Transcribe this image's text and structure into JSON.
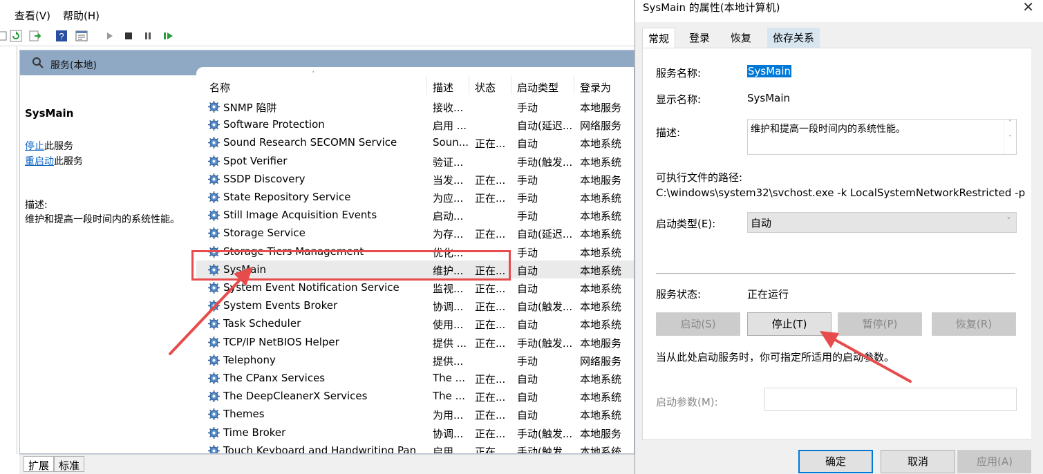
{
  "menu": {
    "view": "查看(V)",
    "help": "帮助(H)"
  },
  "content_header": {
    "title": "服务(本地)"
  },
  "ext_pane": {
    "service_name": "SysMain",
    "stop_link": "停止",
    "stop_suffix": "此服务",
    "restart_link": "重启动",
    "restart_suffix": "此服务",
    "desc_label": "描述:",
    "desc_text": "维护和提高一段时间内的系统性能。"
  },
  "columns": {
    "name": "名称",
    "desc": "描述",
    "status": "状态",
    "startup": "启动类型",
    "logon": "登录为"
  },
  "services": [
    {
      "name": "SNMP 陷阱",
      "desc": "接收...",
      "status": "",
      "startup": "手动",
      "logon": "本地服务"
    },
    {
      "name": "Software Protection",
      "desc": "启用 ...",
      "status": "",
      "startup": "自动(延迟...",
      "logon": "网络服务"
    },
    {
      "name": "Sound Research SECOMN Service",
      "desc": "Soun...",
      "status": "正在...",
      "startup": "自动",
      "logon": "本地系统"
    },
    {
      "name": "Spot Verifier",
      "desc": "验证...",
      "status": "",
      "startup": "手动(触发...",
      "logon": "本地系统"
    },
    {
      "name": "SSDP Discovery",
      "desc": "当发...",
      "status": "正在...",
      "startup": "手动",
      "logon": "本地服务"
    },
    {
      "name": "State Repository Service",
      "desc": "为应...",
      "status": "正在...",
      "startup": "手动",
      "logon": "本地系统"
    },
    {
      "name": "Still Image Acquisition Events",
      "desc": "启动...",
      "status": "",
      "startup": "手动",
      "logon": "本地系统"
    },
    {
      "name": "Storage Service",
      "desc": "为存...",
      "status": "正在...",
      "startup": "自动(延迟...",
      "logon": "本地系统"
    },
    {
      "name": "Storage Tiers Management",
      "desc": "优化...",
      "status": "",
      "startup": "手动",
      "logon": "本地系统"
    },
    {
      "name": "SysMain",
      "desc": "维护...",
      "status": "正在...",
      "startup": "自动",
      "logon": "本地系统",
      "selected": true
    },
    {
      "name": "System Event Notification Service",
      "desc": "监视...",
      "status": "正在...",
      "startup": "自动",
      "logon": "本地系统"
    },
    {
      "name": "System Events Broker",
      "desc": "协调...",
      "status": "正在...",
      "startup": "自动(触发...",
      "logon": "本地系统"
    },
    {
      "name": "Task Scheduler",
      "desc": "使用...",
      "status": "正在...",
      "startup": "自动",
      "logon": "本地系统"
    },
    {
      "name": "TCP/IP NetBIOS Helper",
      "desc": "提供 ...",
      "status": "正在...",
      "startup": "手动(触发...",
      "logon": "本地服务"
    },
    {
      "name": "Telephony",
      "desc": "提供...",
      "status": "",
      "startup": "手动",
      "logon": "网络服务"
    },
    {
      "name": "The CPanx Services",
      "desc": "The ...",
      "status": "正在...",
      "startup": "自动",
      "logon": "本地系统"
    },
    {
      "name": "The DeepCleanerX Services",
      "desc": "The ...",
      "status": "正在...",
      "startup": "自动",
      "logon": "本地系统"
    },
    {
      "name": "Themes",
      "desc": "为用...",
      "status": "正在...",
      "startup": "自动",
      "logon": "本地系统"
    },
    {
      "name": "Time Broker",
      "desc": "协调...",
      "status": "正在...",
      "startup": "手动(触发...",
      "logon": "本地服务"
    },
    {
      "name": "Touch Keyboard and Handwriting Panel S...",
      "desc": "启用...",
      "status": "正在...",
      "startup": "手动(触发...",
      "logon": "本地系统"
    }
  ],
  "bottom_tabs": {
    "extended": "扩展",
    "standard": "标准"
  },
  "dialog": {
    "title": "SysMain 的属性(本地计算机)",
    "tabs": {
      "general": "常规",
      "logon": "登录",
      "recovery": "恢复",
      "dependencies": "依存关系"
    },
    "service_name_label": "服务名称:",
    "service_name_value": "SysMain",
    "display_name_label": "显示名称:",
    "display_name_value": "SysMain",
    "desc_label": "描述:",
    "desc_value": "维护和提高一段时间内的系统性能。",
    "path_label": "可执行文件的路径:",
    "path_value": "C:\\windows\\system32\\svchost.exe -k LocalSystemNetworkRestricted -p",
    "startup_label": "启动类型(E):",
    "startup_value": "自动",
    "status_label": "服务状态:",
    "status_value": "正在运行",
    "btn_start": "启动(S)",
    "btn_stop": "停止(T)",
    "btn_pause": "暂停(P)",
    "btn_resume": "恢复(R)",
    "hint": "当从此处启动服务时，你可指定所适用的启动参数。",
    "params_label": "启动参数(M):",
    "params_value": "",
    "btn_ok": "确定",
    "btn_cancel": "取消",
    "btn_apply": "应用(A)"
  },
  "annotation_color": "#e84b4b",
  "accent_color": "#0078d7"
}
